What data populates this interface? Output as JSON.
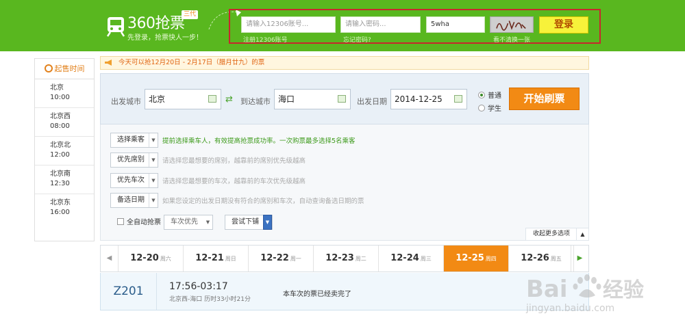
{
  "header": {
    "brand": "360抢票",
    "badge": "三代",
    "slogan": "先登录，抢票快人一步！",
    "login": {
      "username_placeholder": "请输入12306账号...",
      "username_sub": "注册12306账号",
      "password_placeholder": "请输入密码...",
      "password_sub": "忘记密码?",
      "captcha_value": "5wha",
      "captcha_sub": "看不清换一张",
      "login_label": "登录"
    }
  },
  "sidebar": {
    "title": "起售时间",
    "items": [
      {
        "station": "北京",
        "time": "10:00"
      },
      {
        "station": "北京西",
        "time": "08:00"
      },
      {
        "station": "北京北",
        "time": "12:00"
      },
      {
        "station": "北京南",
        "time": "12:30"
      },
      {
        "station": "北京东",
        "time": "16:00"
      }
    ]
  },
  "notice": "今天可以抢12月20日 - 2月17日（腊月廿九）的票",
  "search": {
    "from_label": "出发城市",
    "from_value": "北京",
    "to_label": "到达城市",
    "to_value": "海口",
    "date_label": "出发日期",
    "date_value": "2014-12-25",
    "ticket_types": [
      {
        "label": "普通",
        "selected": true
      },
      {
        "label": "学生",
        "selected": false
      }
    ],
    "start_label": "开始刷票"
  },
  "options": {
    "rows": [
      {
        "button": "选择乘客",
        "hint": "提前选择乘车人，有效提高抢票成功率。一次购票最多选择5名乘客",
        "highlight": true
      },
      {
        "button": "优先席别",
        "hint": "请选择您最想要的席别，越靠前的席别优先级越高",
        "highlight": false
      },
      {
        "button": "优先车次",
        "hint": "请选择您最想要的车次，越靠前的车次优先级越高",
        "highlight": false
      },
      {
        "button": "备选日期",
        "hint": "如果您设定的出发日期没有符合的席别和车次，自动查询备选日期的票",
        "highlight": false
      }
    ],
    "auto_label": "全自动抢票",
    "priority_select": "车次优先",
    "berth_select": "尝试下铺",
    "collapse_label": "收起更多选项"
  },
  "dates": [
    {
      "date": "12-20",
      "weekday": "周六",
      "active": false
    },
    {
      "date": "12-21",
      "weekday": "周日",
      "active": false
    },
    {
      "date": "12-22",
      "weekday": "周一",
      "active": false
    },
    {
      "date": "12-23",
      "weekday": "周二",
      "active": false
    },
    {
      "date": "12-24",
      "weekday": "周三",
      "active": false
    },
    {
      "date": "12-25",
      "weekday": "周四",
      "active": true
    },
    {
      "date": "12-26",
      "weekday": "周五",
      "active": false
    }
  ],
  "train": {
    "code": "Z201",
    "time": "17:56-03:17",
    "route": "北京西-海口 历时33小时21分",
    "status": "本车次的票已经卖完了"
  },
  "watermark": {
    "logo": "Baidu经验",
    "url": "jingyan.baidu.com"
  },
  "colors": {
    "header_green": "#59b71f",
    "accent_orange": "#f28a14",
    "highlight_border": "#c8262d"
  }
}
